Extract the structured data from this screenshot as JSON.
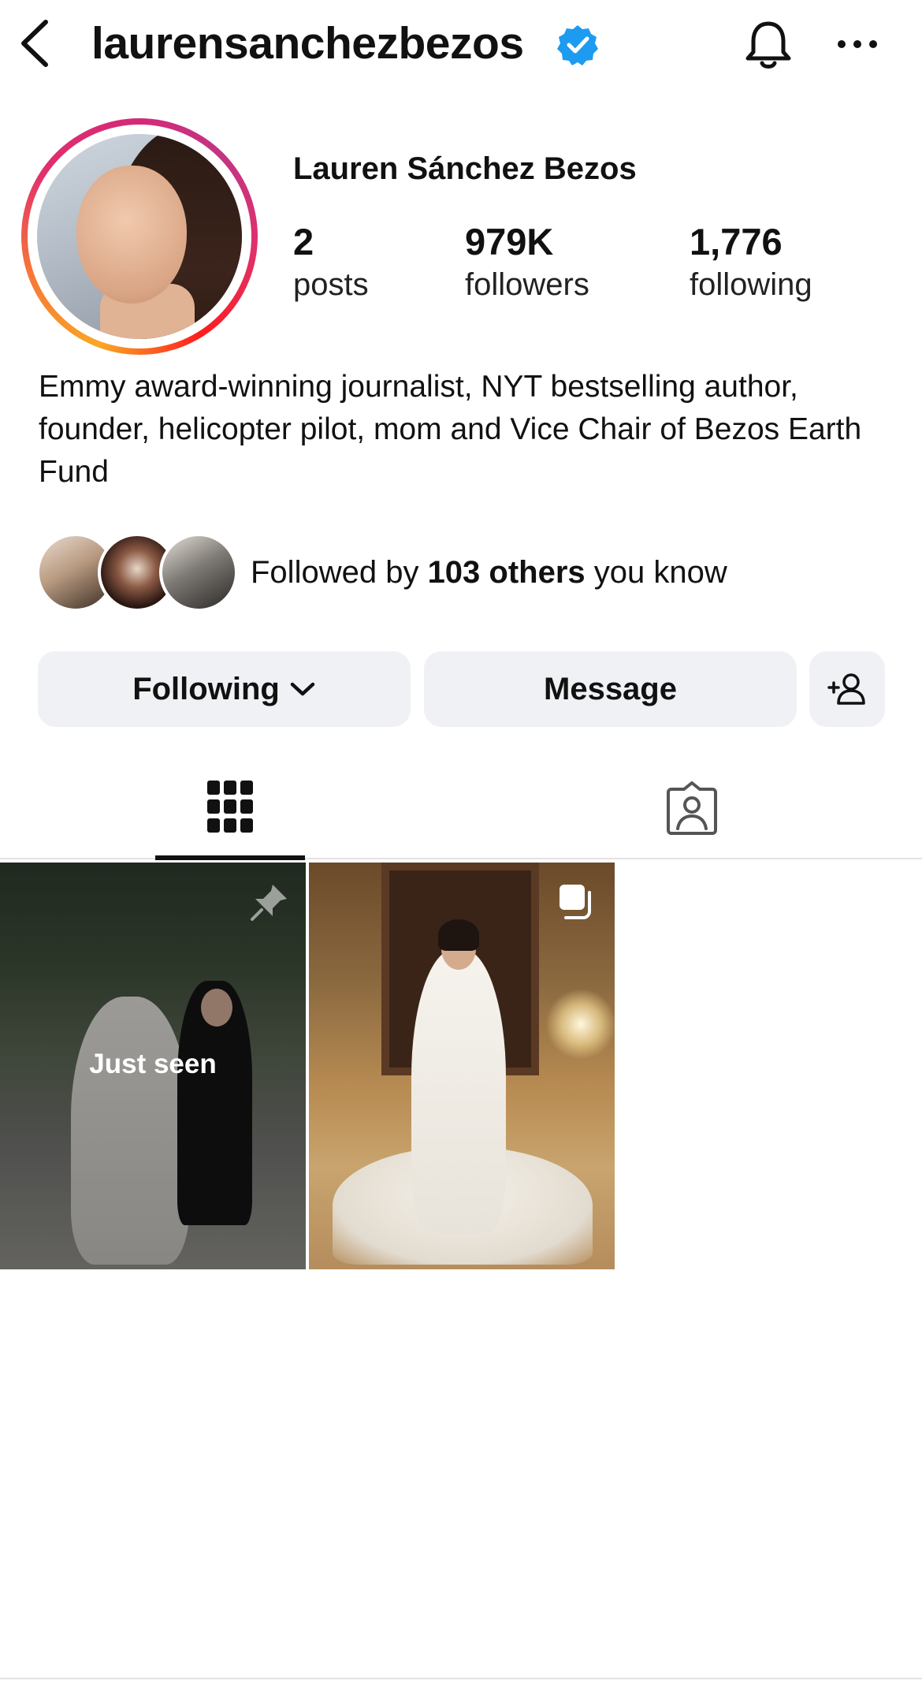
{
  "header": {
    "username": "laurensanchezbezos",
    "verified": true
  },
  "profile": {
    "display_name": "Lauren Sánchez Bezos",
    "stats": [
      {
        "value": "2",
        "label": "posts"
      },
      {
        "value": "979K",
        "label": "followers"
      },
      {
        "value": "1,776",
        "label": "following"
      }
    ],
    "bio": "Emmy award-winning journalist, NYT bestselling author, founder, helicopter pilot, mom and Vice Chair of Bezos Earth Fund",
    "followed_by": {
      "prefix": "Followed by ",
      "bold": "103 others",
      "suffix": " you know"
    }
  },
  "actions": {
    "following_label": "Following",
    "message_label": "Message"
  },
  "tabs": [
    {
      "name": "grid-tab",
      "icon": "grid-icon",
      "active": true
    },
    {
      "name": "tagged-tab",
      "icon": "tagged-icon",
      "active": false
    }
  ],
  "posts": [
    {
      "overlay_text": "Just seen",
      "badge": "pin-icon"
    },
    {
      "overlay_text": "",
      "badge": "multiple-photos-icon"
    }
  ],
  "colors": {
    "verified": "#1d9bf0",
    "button_bg": "#eff1f4",
    "text": "#111111"
  }
}
